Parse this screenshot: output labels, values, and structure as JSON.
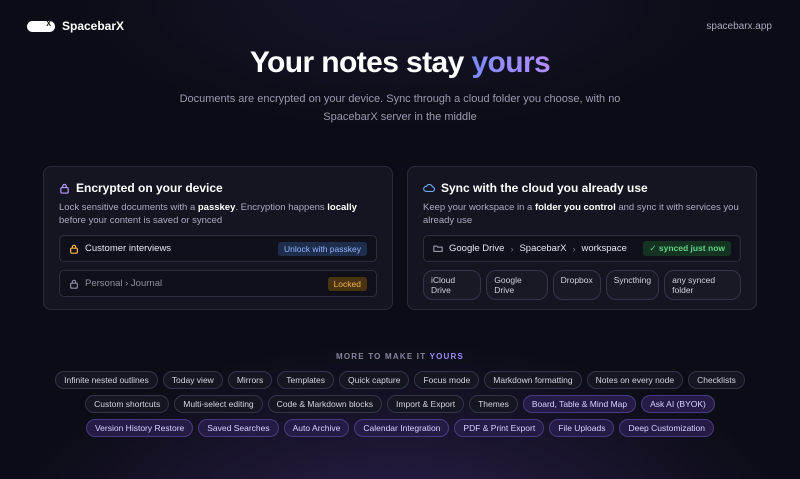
{
  "brand": {
    "name": "SpacebarX",
    "logo_letter": "X",
    "site": "spacebarx.app"
  },
  "hero": {
    "title_plain": "Your notes stay ",
    "title_accent": "yours",
    "subtitle": "Documents are encrypted on your device. Sync through a cloud folder you choose, with no SpacebarX server in the middle"
  },
  "encrypt_card": {
    "title": "Encrypted on your device",
    "desc_1": "Lock sensitive documents with a ",
    "desc_b1": "passkey",
    "desc_2": ". Encryption happens ",
    "desc_b2": "locally",
    "desc_3": " before your content is saved or synced",
    "rows": [
      {
        "label": "Customer interviews",
        "badge": "Unlock with passkey"
      },
      {
        "label": "Personal › Journal",
        "badge": "Locked"
      }
    ]
  },
  "sync_card": {
    "title": "Sync with the cloud you already use",
    "desc_1": "Keep your workspace in a ",
    "desc_b1": "folder you control",
    "desc_2": " and sync it with services you already use",
    "path": [
      "Google Drive",
      "SpacebarX",
      "workspace"
    ],
    "path_sep": "›",
    "status": "✓ synced just now",
    "services": [
      "iCloud Drive",
      "Google Drive",
      "Dropbox",
      "Syncthing",
      "any synced folder"
    ]
  },
  "more": {
    "title_plain": "MORE TO MAKE IT ",
    "title_accent": "YOURS",
    "features": [
      "Infinite nested outlines",
      "Today view",
      "Mirrors",
      "Templates",
      "Quick capture",
      "Focus mode",
      "Markdown formatting",
      "Notes on every node",
      "Checklists",
      "Custom shortcuts",
      "Multi-select editing",
      "Code & Markdown blocks",
      "Import & Export",
      "Themes"
    ],
    "pro_features": [
      "Board, Table & Mind Map",
      "Ask AI (BYOK)",
      "Version History Restore",
      "Saved Searches",
      "Auto Archive",
      "Calendar Integration",
      "PDF & Print Export",
      "File Uploads",
      "Deep Customization"
    ]
  },
  "colors": {
    "accent": "#9d8cff",
    "lock": "#f5b44a",
    "cloud": "#6ea8ff",
    "synced": "#5fd38a"
  }
}
